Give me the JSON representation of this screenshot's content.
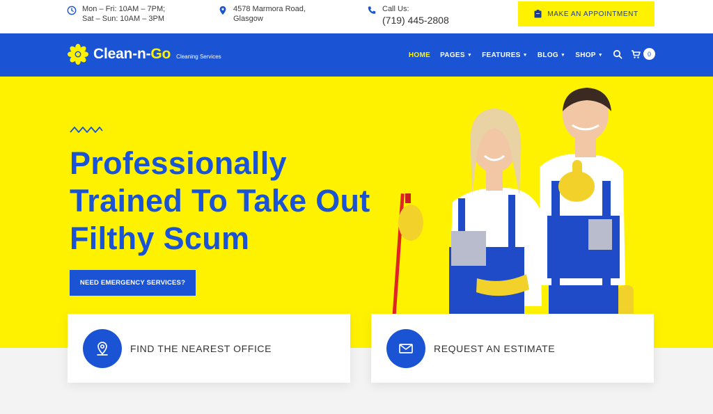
{
  "topbar": {
    "hours": {
      "line1": "Mon – Fri: 10AM – 7PM;",
      "line2": "Sat – Sun: 10AM – 3PM",
      "icon": "clock-icon"
    },
    "address": {
      "line1": "4578 Marmora Road,",
      "line2": "Glasgow",
      "icon": "location-pin-icon"
    },
    "phone": {
      "label": "Call Us:",
      "number": "(719) 445-2808",
      "icon": "phone-icon"
    },
    "appointment_label": "MAKE AN APPOINTMENT"
  },
  "nav": {
    "brand_main": "Clean-n-",
    "brand_accent": "Go",
    "tagline": "Cleaning Services",
    "items": [
      {
        "label": "HOME",
        "active": true,
        "dropdown": false
      },
      {
        "label": "PAGES",
        "active": false,
        "dropdown": true
      },
      {
        "label": "FEATURES",
        "active": false,
        "dropdown": true
      },
      {
        "label": "BLOG",
        "active": false,
        "dropdown": true
      },
      {
        "label": "SHOP",
        "active": false,
        "dropdown": true
      }
    ],
    "cart_count": "0"
  },
  "hero": {
    "headline": [
      "Professionally",
      "Trained To Take Out",
      "Filthy Scum"
    ],
    "cta_label": "NEED EMERGENCY SERVICES?"
  },
  "cards": [
    {
      "label": "FIND THE NEAREST OFFICE",
      "icon": "map-marker-icon"
    },
    {
      "label": "REQUEST AN ESTIMATE",
      "icon": "envelope-icon"
    }
  ],
  "colors": {
    "primary_blue": "#1a54d4",
    "accent_yellow": "#fff200",
    "background": "#f3f3f3"
  }
}
